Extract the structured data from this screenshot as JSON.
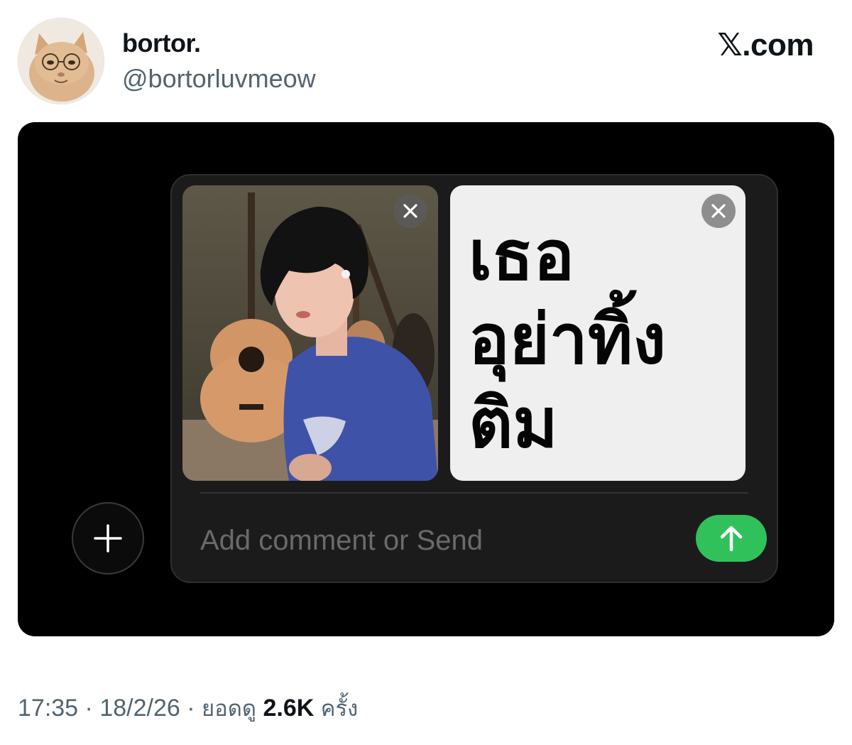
{
  "author": {
    "display_name": "bortor.",
    "handle": "@bortorluvmeow",
    "avatar_icon": "cat-avatar"
  },
  "brand": {
    "logo_text": "𝕏.com"
  },
  "compose": {
    "photo_attachment": {
      "remove_icon": "close-icon"
    },
    "text_attachment": {
      "text": "เธอ\nอุย่าทิ้ง\nติม",
      "remove_icon": "close-icon"
    },
    "comment_placeholder": "Add comment or Send",
    "comment_value": "",
    "send_icon": "arrow-up-icon",
    "add_icon": "plus-icon",
    "colors": {
      "send": "#31c15a",
      "panel": "#1b1b1c"
    }
  },
  "meta": {
    "time": "17:35",
    "date": "18/2/26",
    "views_label": "ยอดดู",
    "views_count": "2.6K",
    "views_suffix": "ครั้ง",
    "separator": "·"
  }
}
